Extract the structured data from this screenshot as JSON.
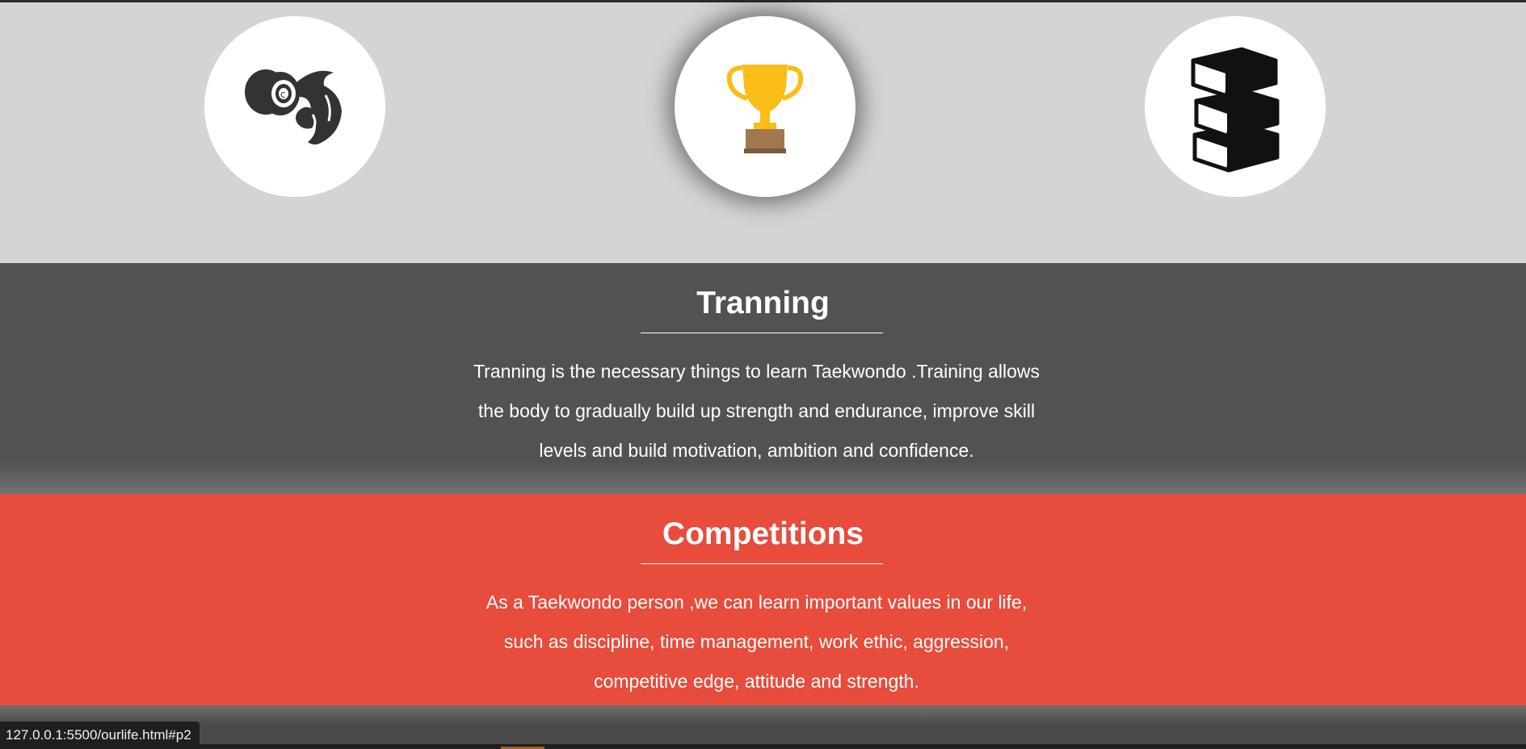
{
  "icons": [
    {
      "name": "strength-icon",
      "label": "dumbbell-arm-icon"
    },
    {
      "name": "trophy-icon",
      "label": "trophy-icon"
    },
    {
      "name": "books-icon",
      "label": "books-icon"
    }
  ],
  "colors": {
    "icon_band": "#d4d4d4",
    "training_bg": "#525252",
    "competitions_bg": "#e74c3c",
    "trophy_gold": "#fbbd17",
    "trophy_base": "#a0784f"
  },
  "training": {
    "title": "Tranning",
    "line1": "Tranning is the necessary things to learn Taekwondo .Training allows",
    "line2": "the body to gradually build up strength and endurance, improve skill",
    "line3": "levels and build motivation, ambition and confidence."
  },
  "competitions": {
    "title": "Competitions",
    "line1": "As a Taekwondo person ,we can learn important values in our life,",
    "line2": "such as discipline, time management, work ethic, aggression,",
    "line3": "competitive edge, attitude and strength."
  },
  "status_bar": {
    "url": "127.0.0.1:5500/ourlife.html#p2"
  }
}
